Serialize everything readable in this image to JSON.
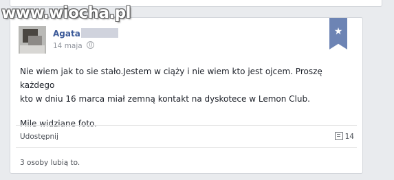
{
  "watermark": "www.wiocha.pl",
  "post": {
    "author_name": "Agata",
    "date": "14 maja",
    "bookmark_icon": "star-icon",
    "paragraphs": [
      "Nie wiem jak to sie stało.Jestem w ciąży i nie wiem kto jest ojcem. Proszę każdego",
      "kto w dniu 16 marca miał zemną kontakt na dyskotece w Lemon Club.",
      "Mile widziane foto."
    ],
    "share_label": "Udostępnij",
    "comment_count": "14",
    "likes_text": "3 osoby lubią to."
  }
}
